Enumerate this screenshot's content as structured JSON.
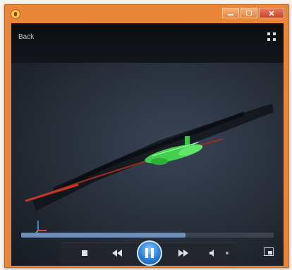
{
  "window": {
    "caption_buttons": [
      "minimize",
      "maximize",
      "close"
    ],
    "frame_color": "#e8863a"
  },
  "header": {
    "back_label": "Back"
  },
  "player": {
    "progress": 0.65,
    "accent_color": "#2a7fd4",
    "controls": [
      {
        "name": "stop",
        "icon": "stop-icon"
      },
      {
        "name": "previous",
        "icon": "previous-icon"
      },
      {
        "name": "pause",
        "icon": "pause-icon"
      },
      {
        "name": "next",
        "icon": "next-icon"
      },
      {
        "name": "volume",
        "icon": "volume-icon"
      },
      {
        "name": "volume-more",
        "icon": "chevron-icon"
      }
    ]
  },
  "icons": [
    "app-icon",
    "fullscreen-icon",
    "switch-to-compact-icon"
  ]
}
